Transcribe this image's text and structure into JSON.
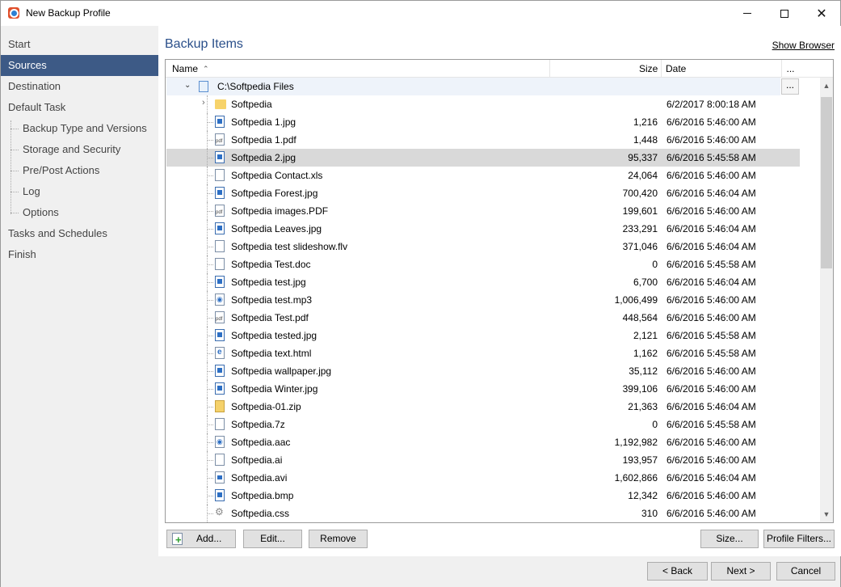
{
  "window": {
    "title": "New Backup Profile"
  },
  "sidebar": {
    "items": [
      {
        "label": "Start"
      },
      {
        "label": "Sources"
      },
      {
        "label": "Destination"
      },
      {
        "label": "Default Task"
      },
      {
        "label": "Backup Type and Versions"
      },
      {
        "label": "Storage and Security"
      },
      {
        "label": "Pre/Post Actions"
      },
      {
        "label": "Log"
      },
      {
        "label": "Options"
      },
      {
        "label": "Tasks and Schedules"
      },
      {
        "label": "Finish"
      }
    ],
    "active": "Sources"
  },
  "main": {
    "title": "Backup Items",
    "show_browser": "Show Browser",
    "columns": {
      "name": "Name",
      "size": "Size",
      "date": "Date",
      "more": "..."
    },
    "root": {
      "label": "C:\\Softpedia Files",
      "more": "..."
    },
    "rows": [
      {
        "name": "Softpedia",
        "size": "",
        "date": "6/2/2017 8:00:18 AM",
        "icon": "folder-icon"
      },
      {
        "name": "Softpedia 1.jpg",
        "size": "1,216",
        "date": "6/6/2016 5:46:00 AM",
        "icon": "image-file-icon"
      },
      {
        "name": "Softpedia 1.pdf",
        "size": "1,448",
        "date": "6/6/2016 5:46:00 AM",
        "icon": "pdf-file-icon"
      },
      {
        "name": "Softpedia 2.jpg",
        "size": "95,337",
        "date": "6/6/2016 5:45:58 AM",
        "icon": "image-file-icon"
      },
      {
        "name": "Softpedia Contact.xls",
        "size": "24,064",
        "date": "6/6/2016 5:46:00 AM",
        "icon": "file-icon"
      },
      {
        "name": "Softpedia Forest.jpg",
        "size": "700,420",
        "date": "6/6/2016 5:46:04 AM",
        "icon": "image-file-icon"
      },
      {
        "name": "Softpedia images.PDF",
        "size": "199,601",
        "date": "6/6/2016 5:46:00 AM",
        "icon": "pdf-file-icon"
      },
      {
        "name": "Softpedia Leaves.jpg",
        "size": "233,291",
        "date": "6/6/2016 5:46:04 AM",
        "icon": "image-file-icon"
      },
      {
        "name": "Softpedia test slideshow.flv",
        "size": "371,046",
        "date": "6/6/2016 5:46:04 AM",
        "icon": "file-icon"
      },
      {
        "name": "Softpedia Test.doc",
        "size": "0",
        "date": "6/6/2016 5:45:58 AM",
        "icon": "file-icon"
      },
      {
        "name": "Softpedia test.jpg",
        "size": "6,700",
        "date": "6/6/2016 5:46:04 AM",
        "icon": "image-file-icon"
      },
      {
        "name": "Softpedia test.mp3",
        "size": "1,006,499",
        "date": "6/6/2016 5:46:00 AM",
        "icon": "audio-file-icon"
      },
      {
        "name": "Softpedia Test.pdf",
        "size": "448,564",
        "date": "6/6/2016 5:46:00 AM",
        "icon": "pdf-file-icon"
      },
      {
        "name": "Softpedia tested.jpg",
        "size": "2,121",
        "date": "6/6/2016 5:45:58 AM",
        "icon": "image-file-icon"
      },
      {
        "name": "Softpedia text.html",
        "size": "1,162",
        "date": "6/6/2016 5:45:58 AM",
        "icon": "html-file-icon"
      },
      {
        "name": "Softpedia wallpaper.jpg",
        "size": "35,112",
        "date": "6/6/2016 5:46:00 AM",
        "icon": "image-file-icon"
      },
      {
        "name": "Softpedia Winter.jpg",
        "size": "399,106",
        "date": "6/6/2016 5:46:00 AM",
        "icon": "image-file-icon"
      },
      {
        "name": "Softpedia-01.zip",
        "size": "21,363",
        "date": "6/6/2016 5:46:04 AM",
        "icon": "zip-file-icon"
      },
      {
        "name": "Softpedia.7z",
        "size": "0",
        "date": "6/6/2016 5:45:58 AM",
        "icon": "file-icon"
      },
      {
        "name": "Softpedia.aac",
        "size": "1,192,982",
        "date": "6/6/2016 5:46:00 AM",
        "icon": "audio-file-icon"
      },
      {
        "name": "Softpedia.ai",
        "size": "193,957",
        "date": "6/6/2016 5:46:00 AM",
        "icon": "file-icon"
      },
      {
        "name": "Softpedia.avi",
        "size": "1,602,866",
        "date": "6/6/2016 5:46:04 AM",
        "icon": "video-file-icon"
      },
      {
        "name": "Softpedia.bmp",
        "size": "12,342",
        "date": "6/6/2016 5:46:00 AM",
        "icon": "image-file-icon"
      },
      {
        "name": "Softpedia.css",
        "size": "310",
        "date": "6/6/2016 5:46:00 AM",
        "icon": "css-file-icon"
      }
    ],
    "selected_row": "Softpedia 2.jpg",
    "buttons": {
      "add": "Add...",
      "edit": "Edit...",
      "remove": "Remove",
      "size": "Size...",
      "profile_filters": "Profile Filters..."
    }
  },
  "footer": {
    "back": "< Back",
    "next": "Next >",
    "cancel": "Cancel"
  },
  "colors": {
    "sidebar_active": "#3d5a86",
    "title_accent": "#2a4f8a",
    "selected_row": "#d9d9d9"
  }
}
